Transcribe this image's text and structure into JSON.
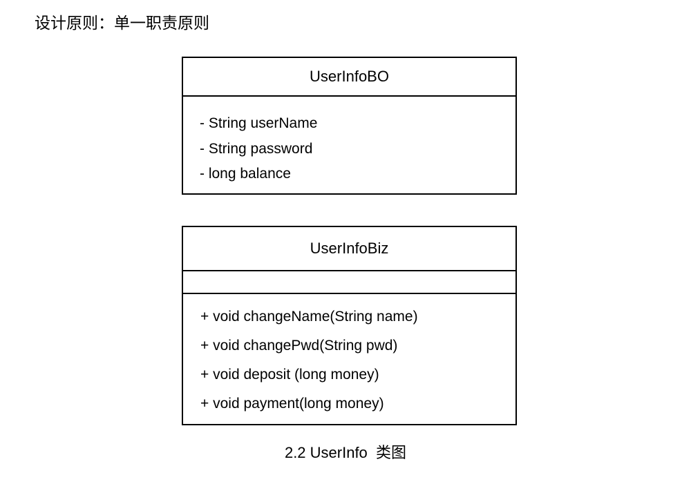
{
  "title": "设计原则：单一职责原则",
  "classes": [
    {
      "name": "UserInfoBO",
      "attributes": [
        "- String userName",
        "- String password",
        "- long balance"
      ],
      "methods": []
    },
    {
      "name": "UserInfoBiz",
      "attributes": [],
      "methods": [
        "+ void changeName(String name)",
        "+ void changePwd(String pwd)",
        "+ void deposit (long money)",
        "+ void payment(long money)"
      ]
    }
  ],
  "caption": "2.2 UserInfo  类图"
}
